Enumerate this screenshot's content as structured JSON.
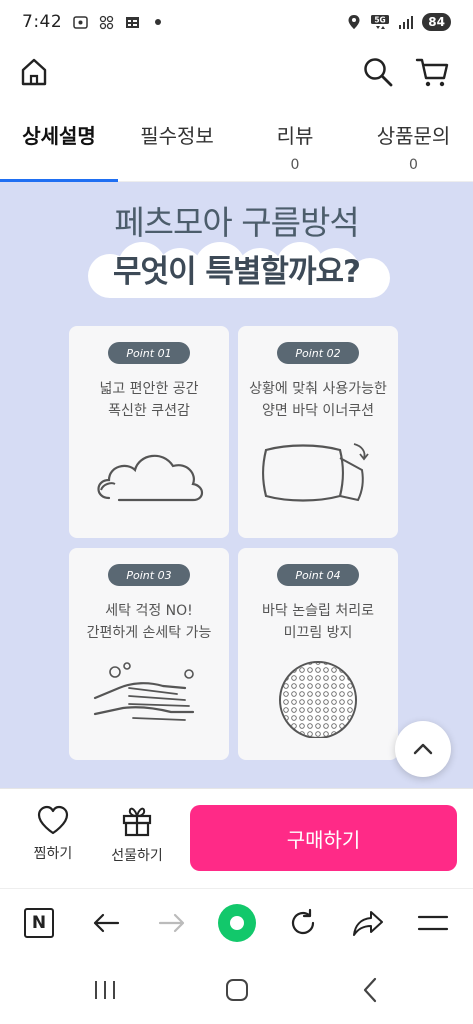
{
  "status_bar": {
    "time": "7:42",
    "battery": "84",
    "network": "5G"
  },
  "tabs": [
    {
      "label": "상세설명",
      "count": ""
    },
    {
      "label": "필수정보",
      "count": ""
    },
    {
      "label": "리뷰",
      "count": "0"
    },
    {
      "label": "상품문의",
      "count": "0"
    }
  ],
  "detail": {
    "title_line1": "페츠모아 구름방석",
    "title_line2": "무엇이 특별할까요?",
    "cards": [
      {
        "badge": "Point 01",
        "line1": "넓고 편안한 공간",
        "line2": "폭신한 쿠션감",
        "icon": "cloud-icon"
      },
      {
        "badge": "Point 02",
        "line1": "상황에 맞춰 사용가능한",
        "line2": "양면 바닥 이너쿠션",
        "icon": "pillow-flip-icon"
      },
      {
        "badge": "Point 03",
        "line1": "세탁 걱정 NO!",
        "line2": "간편하게 손세탁 가능",
        "icon": "hand-wash-icon"
      },
      {
        "badge": "Point 04",
        "line1": "바닥 논슬립 처리로",
        "line2": "미끄림 방지",
        "icon": "non-slip-dots-icon"
      }
    ]
  },
  "purchase_bar": {
    "wish_label": "찜하기",
    "gift_label": "선물하기",
    "buy_label": "구매하기"
  },
  "browser_bar": {
    "naver_label": "N"
  },
  "colors": {
    "accent_blue": "#1f6ff2",
    "buy_pink": "#ff2a87",
    "banner_bg": "#d6dcf4",
    "browser_green": "#12c86b"
  }
}
